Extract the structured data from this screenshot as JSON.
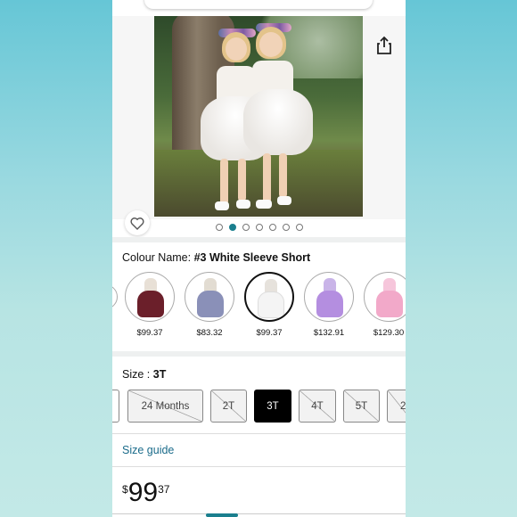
{
  "gallery": {
    "image_alt": "Two girls in white lace tulle dresses hugging by a tree",
    "dots_count": 7,
    "active_dot_index": 1
  },
  "colour": {
    "label": "Colour Name: ",
    "value": "#3 White Sleeve Short"
  },
  "swatches": [
    {
      "price": "$99.37",
      "color": "#6b1f2a",
      "selected": false
    },
    {
      "price": "$83.32",
      "color": "#8a90b8",
      "selected": false
    },
    {
      "price": "$99.37",
      "color": "#f4f4f4",
      "selected": true
    },
    {
      "price": "$132.91",
      "color": "#b48ee0",
      "selected": false
    },
    {
      "price": "$129.30",
      "color": "#f2a9c9",
      "selected": false
    }
  ],
  "size": {
    "label": "Size : ",
    "value": "3T",
    "options": [
      {
        "label": "",
        "state": "available"
      },
      {
        "label": "24 Months",
        "state": "unavailable"
      },
      {
        "label": "2T",
        "state": "unavailable"
      },
      {
        "label": "3T",
        "state": "selected"
      },
      {
        "label": "4T",
        "state": "unavailable"
      },
      {
        "label": "5T",
        "state": "unavailable"
      },
      {
        "label": "2",
        "state": "unavailable"
      }
    ]
  },
  "size_guide": "Size guide",
  "price": {
    "currency": "$",
    "whole": "99",
    "fraction": "37"
  },
  "colors": {
    "accent": "#1a7f8e",
    "link": "#1a6b8a"
  }
}
